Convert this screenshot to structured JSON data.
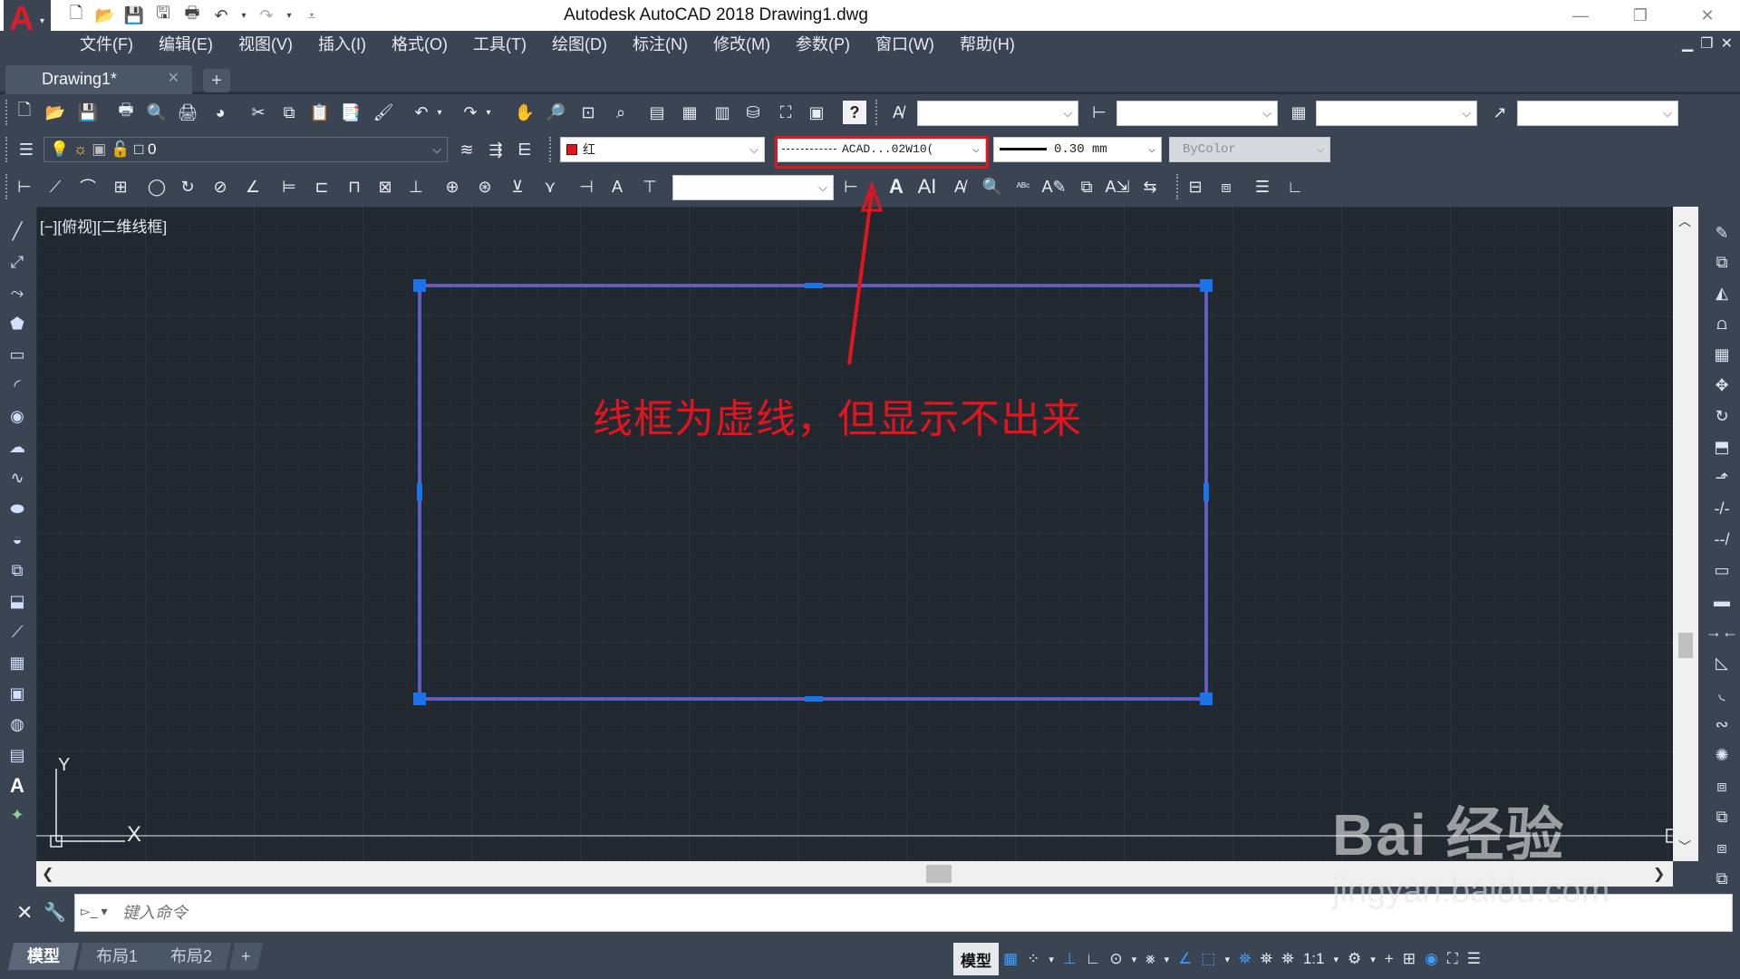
{
  "window": {
    "title": "Autodesk AutoCAD 2018    Drawing1.dwg",
    "logo_letter": "A"
  },
  "menu": [
    "文件(F)",
    "编辑(E)",
    "视图(V)",
    "插入(I)",
    "格式(O)",
    "工具(T)",
    "绘图(D)",
    "标注(N)",
    "修改(M)",
    "参数(P)",
    "窗口(W)",
    "帮助(H)"
  ],
  "tabs": {
    "document": "Drawing1*",
    "add_symbol": "+"
  },
  "properties": {
    "layer_name": "0",
    "color_value": "红",
    "linetype_value": "ACAD...02W10(",
    "lineweight_value": "0.30 mm",
    "plotstyle_value": "ByColor"
  },
  "viewport": {
    "label": "[−][俯视][二维线框]"
  },
  "annotation": {
    "text": "线框为虚线，但显示不出来",
    "color": "#e2141d"
  },
  "rectangle": {
    "edge_color": "#9a4aa0",
    "grip_color": "#1a73e8"
  },
  "ucs": {
    "y_label": "Y",
    "x_label": "X"
  },
  "command": {
    "placeholder": "键入命令"
  },
  "layout_tabs": [
    "模型",
    "布局1",
    "布局2"
  ],
  "status": {
    "model": "模型",
    "scale": "1:1"
  },
  "watermark": {
    "brand": "Bai 经验",
    "url": "jingyan.baidu.com"
  }
}
